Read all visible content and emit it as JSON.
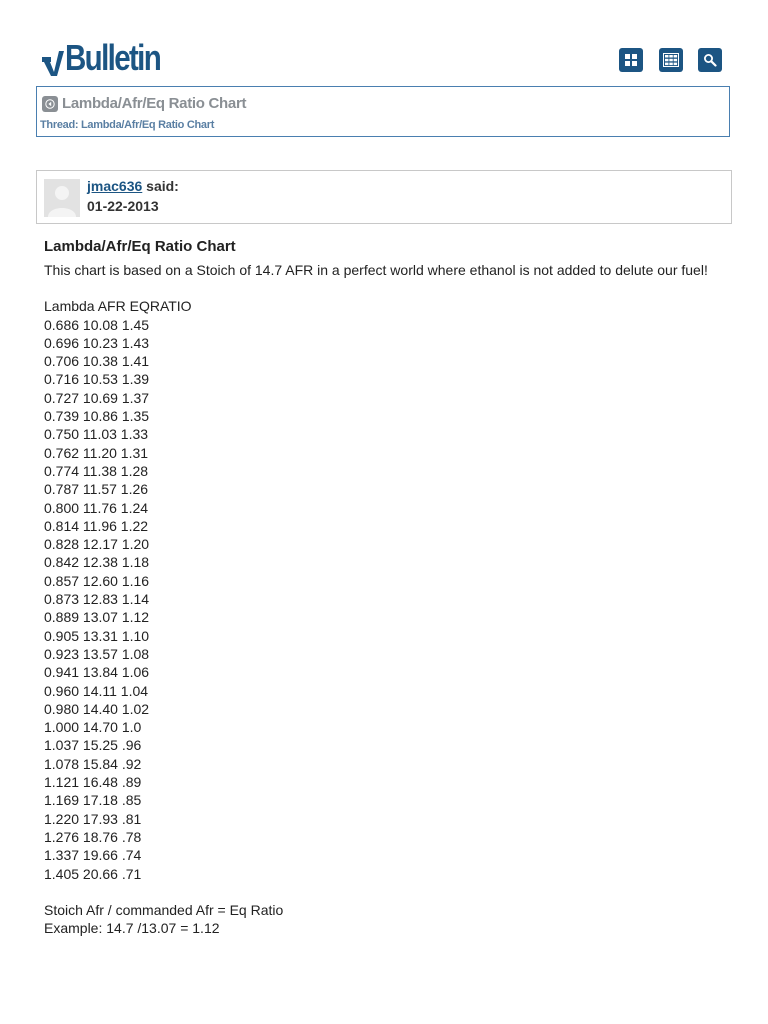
{
  "header": {
    "logo_prefix": "v",
    "logo_text": "Bulletin",
    "buttons": [
      {
        "icon": "grid-2x2-icon"
      },
      {
        "icon": "grid-3x3-icon"
      },
      {
        "icon": "search-icon"
      }
    ]
  },
  "breadcrumb": {
    "title": "Lambda/Afr/Eq Ratio Chart",
    "thread_label": "Thread:",
    "thread_link": "Lambda/Afr/Eq Ratio Chart"
  },
  "post": {
    "author": "jmac636",
    "said": "said:",
    "date": "01-22-2013",
    "title": "Lambda/Afr/Eq Ratio Chart",
    "intro": "This chart is based on a Stoich of 14.7 AFR in a perfect world where ethanol is not added to delute our fuel!",
    "table_header": "Lambda AFR EQRATIO",
    "rows": [
      "0.686 10.08 1.45",
      "0.696 10.23 1.43",
      "0.706 10.38 1.41",
      "0.716 10.53 1.39",
      "0.727 10.69 1.37",
      "0.739 10.86 1.35",
      "0.750 11.03 1.33",
      "0.762 11.20 1.31",
      "0.774 11.38 1.28",
      "0.787 11.57 1.26",
      "0.800 11.76 1.24",
      "0.814 11.96 1.22",
      "0.828 12.17 1.20",
      "0.842 12.38 1.18",
      "0.857 12.60 1.16",
      "0.873 12.83 1.14",
      "0.889 13.07 1.12",
      "0.905 13.31 1.10",
      "0.923 13.57 1.08",
      "0.941 13.84 1.06",
      "0.960 14.11 1.04",
      "0.980 14.40 1.02",
      "1.000 14.70 1.0",
      "1.037 15.25 .96",
      "1.078 15.84 .92",
      "1.121 16.48 .89",
      "1.169 17.18 .85",
      "1.220 17.93 .81",
      "1.276 18.76 .78",
      "1.337 19.66 .74",
      "1.405 20.66 .71"
    ],
    "formula": "Stoich Afr / commanded Afr = Eq Ratio",
    "example": "Example: 14.7 /13.07 = 1.12"
  }
}
